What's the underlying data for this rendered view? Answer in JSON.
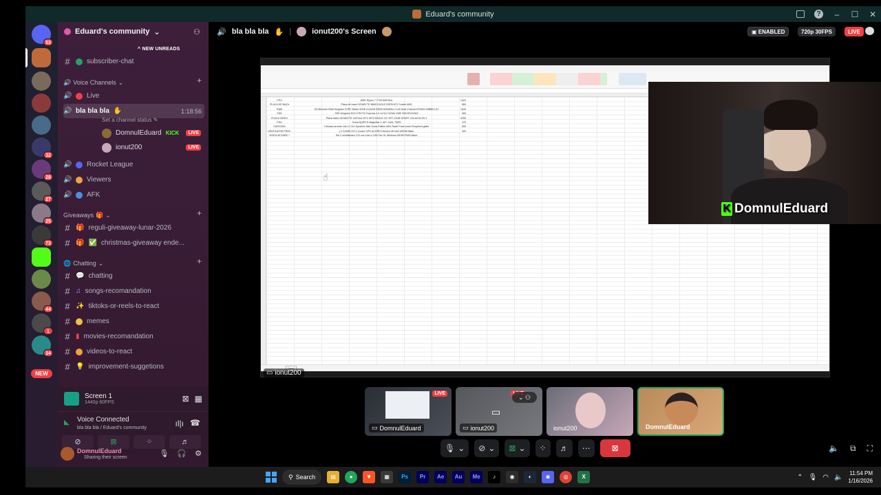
{
  "window": {
    "title": "Eduard's community"
  },
  "server_rail": {
    "badges": [
      "53",
      "32",
      "28",
      "27",
      "25",
      "73",
      "44",
      "1",
      "34"
    ],
    "new_label": "NEW"
  },
  "sidebar": {
    "guild_name": "Eduard's community",
    "new_unreads": "NEW UNREADS",
    "partial_channel": "subscriber-chat",
    "voice_category": "Voice Channels",
    "channels": {
      "live": "Live",
      "active_voice": "bla bla bla",
      "active_time": "1:18:56",
      "status_prompt": "Set a channel status",
      "rocket": "Rocket League",
      "viewers": "Viewers",
      "afk": "AFK"
    },
    "voice_users": [
      {
        "name": "DomnulEduard",
        "tag": "KICK",
        "badge": "LIVE"
      },
      {
        "name": "ionut200",
        "badge": "LIVE"
      }
    ],
    "giveaways_category": "Giveaways",
    "giveaway_channels": [
      "reguli-giveaway-lunar-2026",
      "christmas-giveaway ende..."
    ],
    "chatting_category": "Chatting",
    "chatting_channels": [
      "chatting",
      "songs-recomandation",
      "tiktoks-or-reels-to-react",
      "memes",
      "movies-recomandation",
      "videos-to-react",
      "improvement-suggetions"
    ],
    "screen_panel": {
      "title": "Screen 1",
      "sub": "1440p 60FPS"
    },
    "voice_panel": {
      "status": "Voice Connected",
      "location": "bla bla bla / Eduard's community"
    },
    "user": {
      "name": "DomnulEduard",
      "status": "Sharing their screen"
    }
  },
  "stage": {
    "channel": "bla bla bla",
    "screen_title": "ionut200's Screen",
    "enabled": "ENABLED",
    "quality": "720p 30FPS",
    "live": "LIVE",
    "owner_label": "ionut200",
    "streamer_name": "DomnulEduard",
    "tiles": [
      {
        "label": "DomnulEduard",
        "badge": "LIVE",
        "color": "#3a3f48"
      },
      {
        "label": "ionut200",
        "badge": "LIVE",
        "color": "#5a5c62"
      },
      {
        "label": "ionut200",
        "color": "#c8a8b8"
      },
      {
        "label": "DomnulEduard",
        "color": "#c79a6a"
      }
    ]
  },
  "excel_rows": [
    {
      "a": "CPU",
      "b": "AMD Ryzen 7 7700 AM5 Box",
      "c": "1420"
    },
    {
      "a": "PLACA DE BAZA",
      "b": "Placa de baza GIGABYTE B650 EAGLE DDR5 ATX Socket AM5",
      "c": "860"
    },
    {
      "a": "RAM",
      "b": "Kit Memorie RAM Kingston FURY Beast 32GB 2x16GB DDR5 5200MHz CL40 Dual Channel KF552C40BBK2-32",
      "c": "1640"
    },
    {
      "a": "SSD",
      "b": "SSD Kingston NV3 1TB PCI Express 4.0 x4 M.2 NVMe 2280 SNV3S/1000G",
      "c": "360"
    },
    {
      "a": "PLACA VIDEO",
      "b": "Placa video GIGABYTE GeForce RTX 5070 EAGLE OC SFF 12GB GDDR7 192-bit DLSS 4",
      "c": "3250"
    },
    {
      "a": "PSU",
      "b": "Sursa AQIRYS Magnetar 2, 80+ Gold, 750W",
      "c": "470"
    },
    {
      "a": "CARCASA",
      "b": "Carcasa arrantz Lian Li O11 Dynamic Mini Snow Edition Mini-Tower Fara sursa Tempered glass",
      "c": "650"
    },
    {
      "a": "VENTILATOR PROC",
      "b": "[ 2 CONECOTI ] Cooler CPU ACGRFS Aurora 240 AIO ARGB Black",
      "c": "320"
    },
    {
      "a": "VENTILATOARE +",
      "b": "Set 3 ventilatoare 120 mm Lian Li UNI Fan SL Wireless ARGB PWM Black",
      "c": ""
    }
  ],
  "taskbar": {
    "search": "Search",
    "time": "11:54 PM",
    "date": "1/16/2026"
  },
  "colors": {
    "kick_green": "#53fc18",
    "live_red": "#f23f43",
    "sidebar_bg": "#3e1f3b",
    "voice_green": "#23a55a"
  }
}
